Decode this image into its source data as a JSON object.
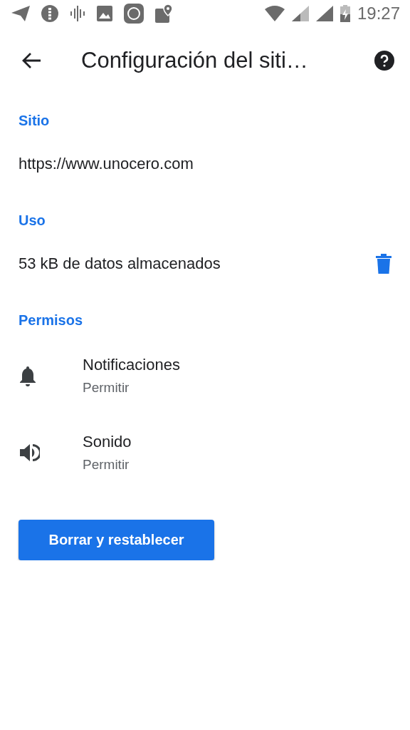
{
  "status_bar": {
    "time": "19:27"
  },
  "app_bar": {
    "title": "Configuración del siti…"
  },
  "sections": [
    {
      "kind": "url",
      "heading": "Sitio",
      "text": "https://www.unocero.com"
    },
    {
      "kind": "storage",
      "heading": "Uso",
      "text": "53 kB de datos almacenados"
    },
    {
      "kind": "permissions",
      "heading": "Permisos",
      "items": [
        {
          "kind": "bell",
          "title": "Notificaciones",
          "value": "Permitir"
        },
        {
          "kind": "speaker",
          "title": "Sonido",
          "value": "Permitir"
        }
      ]
    }
  ],
  "button": {
    "label": "Borrar y restablecer"
  }
}
